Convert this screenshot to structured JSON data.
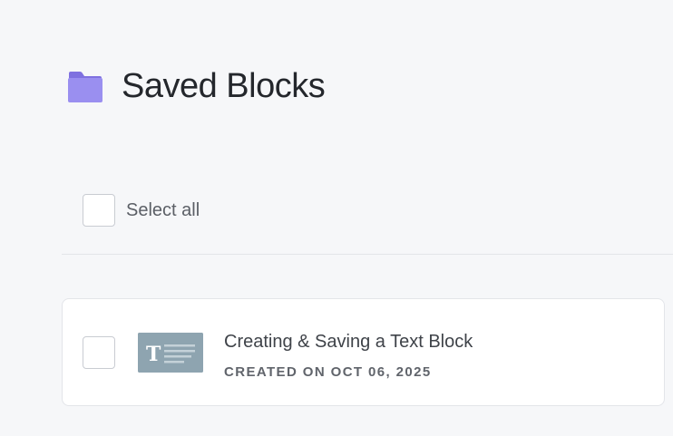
{
  "header": {
    "title": "Saved Blocks",
    "icon": "folder-icon",
    "icon_color": "#9a8ff0"
  },
  "select_all": {
    "label": "Select all",
    "checked": false
  },
  "blocks": [
    {
      "title": "Creating & Saving a Text Block",
      "meta": "CREATED ON OCT 06, 2025",
      "thumbnail_icon": "text-block-icon",
      "thumbnail_color": "#8ea4b0",
      "checked": false
    }
  ]
}
